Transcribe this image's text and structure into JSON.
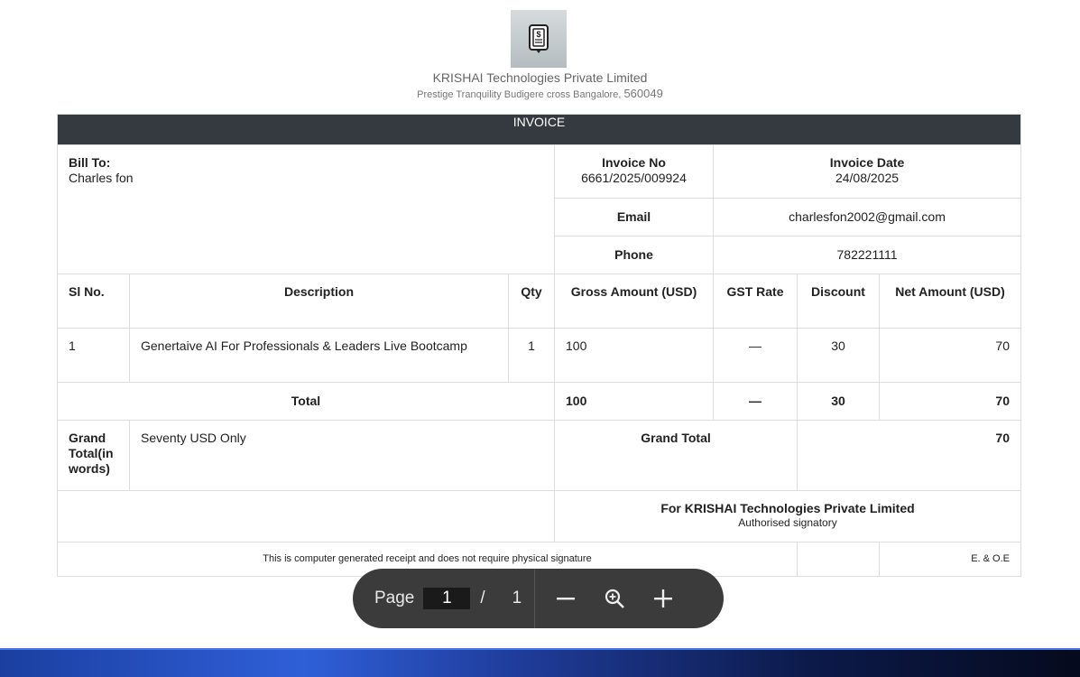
{
  "company": {
    "name": "KRISHAI Technologies Private Limited",
    "address": "Prestige Tranquility Budigere cross Bangalore,",
    "pincode": "560049",
    "logo_icon": "invoice-dollar-icon"
  },
  "invoice": {
    "heading": "INVOICE",
    "bill_to_label": "Bill To:",
    "bill_to_name": "Charles fon",
    "invoice_no_label": "Invoice No",
    "invoice_no": "6661/2025/009924",
    "invoice_date_label": "Invoice Date",
    "invoice_date": "24/08/2025",
    "email_label": "Email",
    "email": "charlesfon2002@gmail.com",
    "phone_label": "Phone",
    "phone": "782221111"
  },
  "columns": {
    "sl_no": "Sl No.",
    "description": "Description",
    "qty": "Qty",
    "gross_amount": "Gross Amount (USD)",
    "gst_rate": "GST Rate",
    "discount": "Discount",
    "net_amount": "Net Amount (USD)"
  },
  "items": [
    {
      "sl_no": "1",
      "description": "Genertaive AI For Professionals & Leaders Live Bootcamp",
      "qty": "1",
      "gross_amount": "100",
      "gst_rate": "—",
      "discount": "30",
      "net_amount": "70"
    }
  ],
  "totals": {
    "label": "Total",
    "gross_amount": "100",
    "gst_rate": "—",
    "discount": "30",
    "net_amount": "70"
  },
  "grand_total": {
    "words_label": "Grand Total(in words)",
    "words": "Seventy USD Only",
    "label": "Grand Total",
    "value": "70"
  },
  "signatory": {
    "for_company": "For KRISHAI Technologies Private Limited",
    "title": "Authorised signatory"
  },
  "footer": {
    "note": "This is computer generated receipt and does not require physical signature",
    "eoe": "E. & O.E"
  },
  "pdf_toolbar": {
    "page_label": "Page",
    "current_page": "1",
    "separator": "/",
    "total_pages": "1",
    "zoom_out_icon": "minus-icon",
    "zoom_fit_icon": "zoom-icon",
    "zoom_in_icon": "plus-icon"
  }
}
